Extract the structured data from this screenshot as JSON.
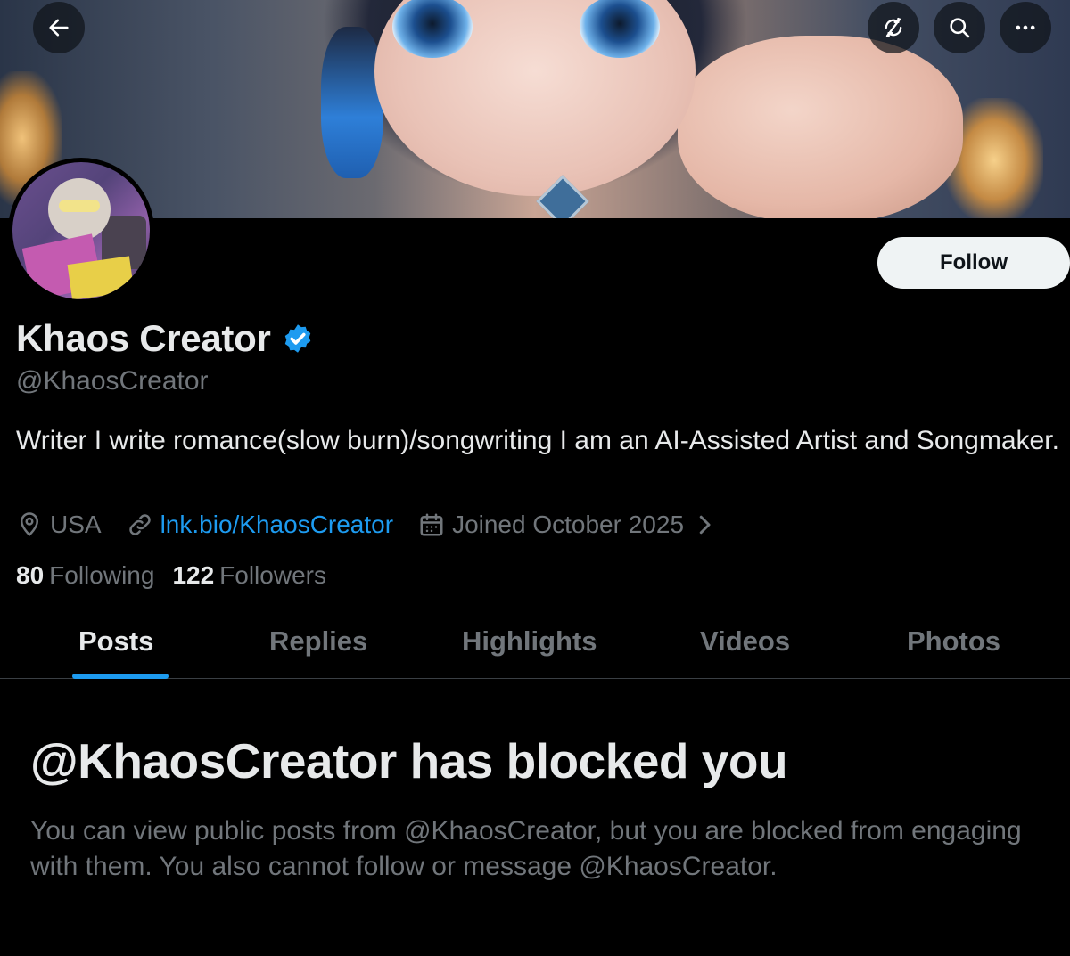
{
  "top_bar": {
    "back_icon": "arrow-left-icon",
    "sync_icon": "refresh-slash-icon",
    "search_icon": "search-icon",
    "more_icon": "more-horizontal-icon"
  },
  "profile": {
    "follow_label": "Follow",
    "display_name": "Khaos Creator",
    "verified_icon": "verified-badge-icon",
    "handle": "@KhaosCreator",
    "bio": "Writer I write romance(slow burn)/songwriting I am an AI-Assisted Artist and Songmaker.",
    "location": "USA",
    "link": "lnk.bio/KhaosCreator",
    "joined": "Joined October 2025",
    "following_count": "80",
    "following_label": "Following",
    "followers_count": "122",
    "followers_label": "Followers"
  },
  "tabs": [
    {
      "label": "Posts",
      "active": true
    },
    {
      "label": "Replies",
      "active": false
    },
    {
      "label": "Highlights",
      "active": false
    },
    {
      "label": "Videos",
      "active": false
    },
    {
      "label": "Photos",
      "active": false
    }
  ],
  "blocked": {
    "title": "@KhaosCreator has blocked you",
    "description": "You can view public posts from @KhaosCreator, but you are blocked from engaging with them. You also cannot follow or message @KhaosCreator."
  },
  "colors": {
    "accent": "#1d9bf0",
    "background": "#000000",
    "text_primary": "#e7e9ea",
    "text_secondary": "#71767b",
    "follow_button_bg": "#eff3f4"
  }
}
